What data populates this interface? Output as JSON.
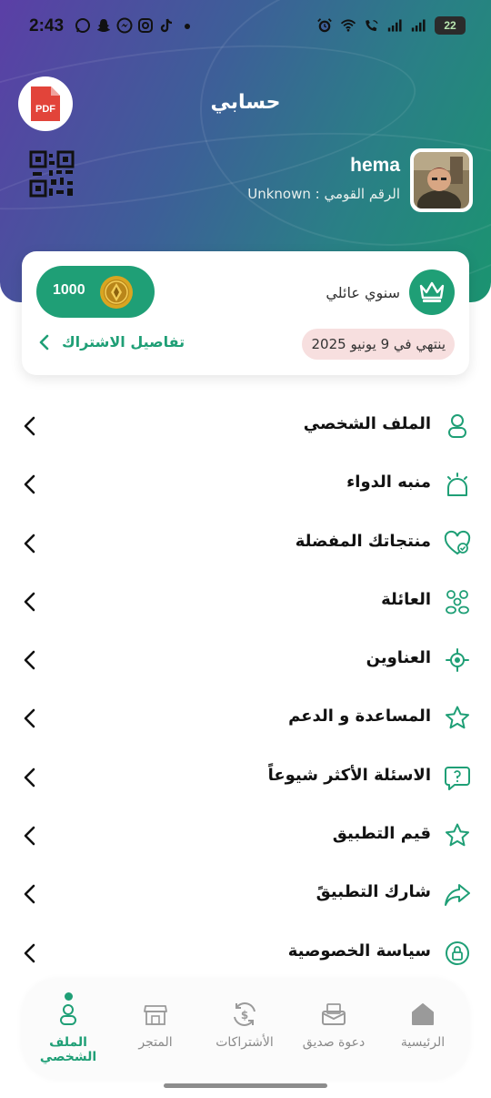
{
  "status_bar": {
    "time": "2:43",
    "battery": "22",
    "left_icons": [
      "whatsapp-icon",
      "snapchat-icon",
      "messenger-icon",
      "instagram-icon",
      "tiktok-icon",
      "dot-icon"
    ],
    "right_icons": [
      "alarm-icon",
      "wifi-icon",
      "wifi-call-icon",
      "signal-icon",
      "signal-icon",
      "battery-icon"
    ]
  },
  "header": {
    "title": "حسابي",
    "pdf_label": "PDF"
  },
  "profile": {
    "name": "hema",
    "national_id": "الرقم القومي : Unknown"
  },
  "subscription": {
    "coins": "1000",
    "plan": "سنوي عائلي",
    "details_link": "تفاصيل الاشتراك",
    "expiry": "ينتهي في 9 يونيو 2025"
  },
  "menu": [
    {
      "label": "الملف الشخصي",
      "icon": "user-icon"
    },
    {
      "label": "منبه الدواء",
      "icon": "alarm-bell-icon"
    },
    {
      "label": "منتجاتك المفضلة",
      "icon": "favorite-heart-icon"
    },
    {
      "label": "العائلة",
      "icon": "family-icon"
    },
    {
      "label": "العناوين",
      "icon": "location-icon"
    },
    {
      "label": "المساعدة و الدعم",
      "icon": "star-icon"
    },
    {
      "label": "الاسئلة الأكثر شيوعاً",
      "icon": "question-icon"
    },
    {
      "label": "قيم التطبيق",
      "icon": "rate-star-icon"
    },
    {
      "label": "شارك التطبيقً",
      "icon": "share-icon"
    },
    {
      "label": "سياسة الخصوصية",
      "icon": "lock-icon"
    }
  ],
  "bottom_nav": [
    {
      "label": "الملف الشخصي",
      "icon": "profile-icon",
      "active": true
    },
    {
      "label": "المتجر",
      "icon": "store-icon",
      "active": false
    },
    {
      "label": "الأشتراكات",
      "icon": "subscriptions-icon",
      "active": false
    },
    {
      "label": "دعوة صديق",
      "icon": "invite-icon",
      "active": false
    },
    {
      "label": "الرئيسية",
      "icon": "home-icon",
      "active": false
    }
  ],
  "colors": {
    "accent": "#1f9f76",
    "expiry_bg": "#f7dfdf",
    "header_gradient_start": "#5b3fa6",
    "header_gradient_end": "#1b9470"
  }
}
